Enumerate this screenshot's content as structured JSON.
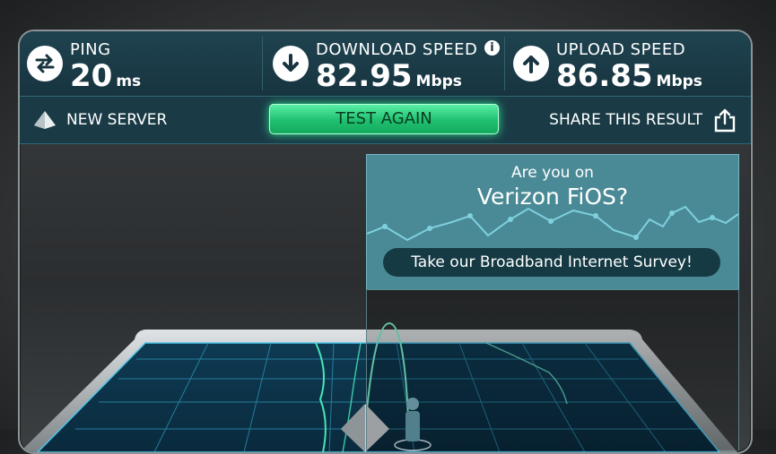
{
  "stats": {
    "ping": {
      "label": "PING",
      "value": "20",
      "unit": "ms"
    },
    "download": {
      "label": "DOWNLOAD SPEED",
      "value": "82.95",
      "unit": "Mbps",
      "info_symbol": "i"
    },
    "upload": {
      "label": "UPLOAD SPEED",
      "value": "86.85",
      "unit": "Mbps"
    }
  },
  "actions": {
    "new_server_label": "NEW SERVER",
    "test_again_label": "TEST AGAIN",
    "share_label": "SHARE THIS RESULT"
  },
  "survey": {
    "question": "Are you on",
    "brand": "Verizon FiOS?",
    "cta": "Take our Broadband Internet Survey!"
  },
  "colors": {
    "accent_green": "#1fbf6e",
    "panel_teal": "#173440",
    "survey_bg": "#4a8a96",
    "map_grid": "#2f9ec0"
  }
}
